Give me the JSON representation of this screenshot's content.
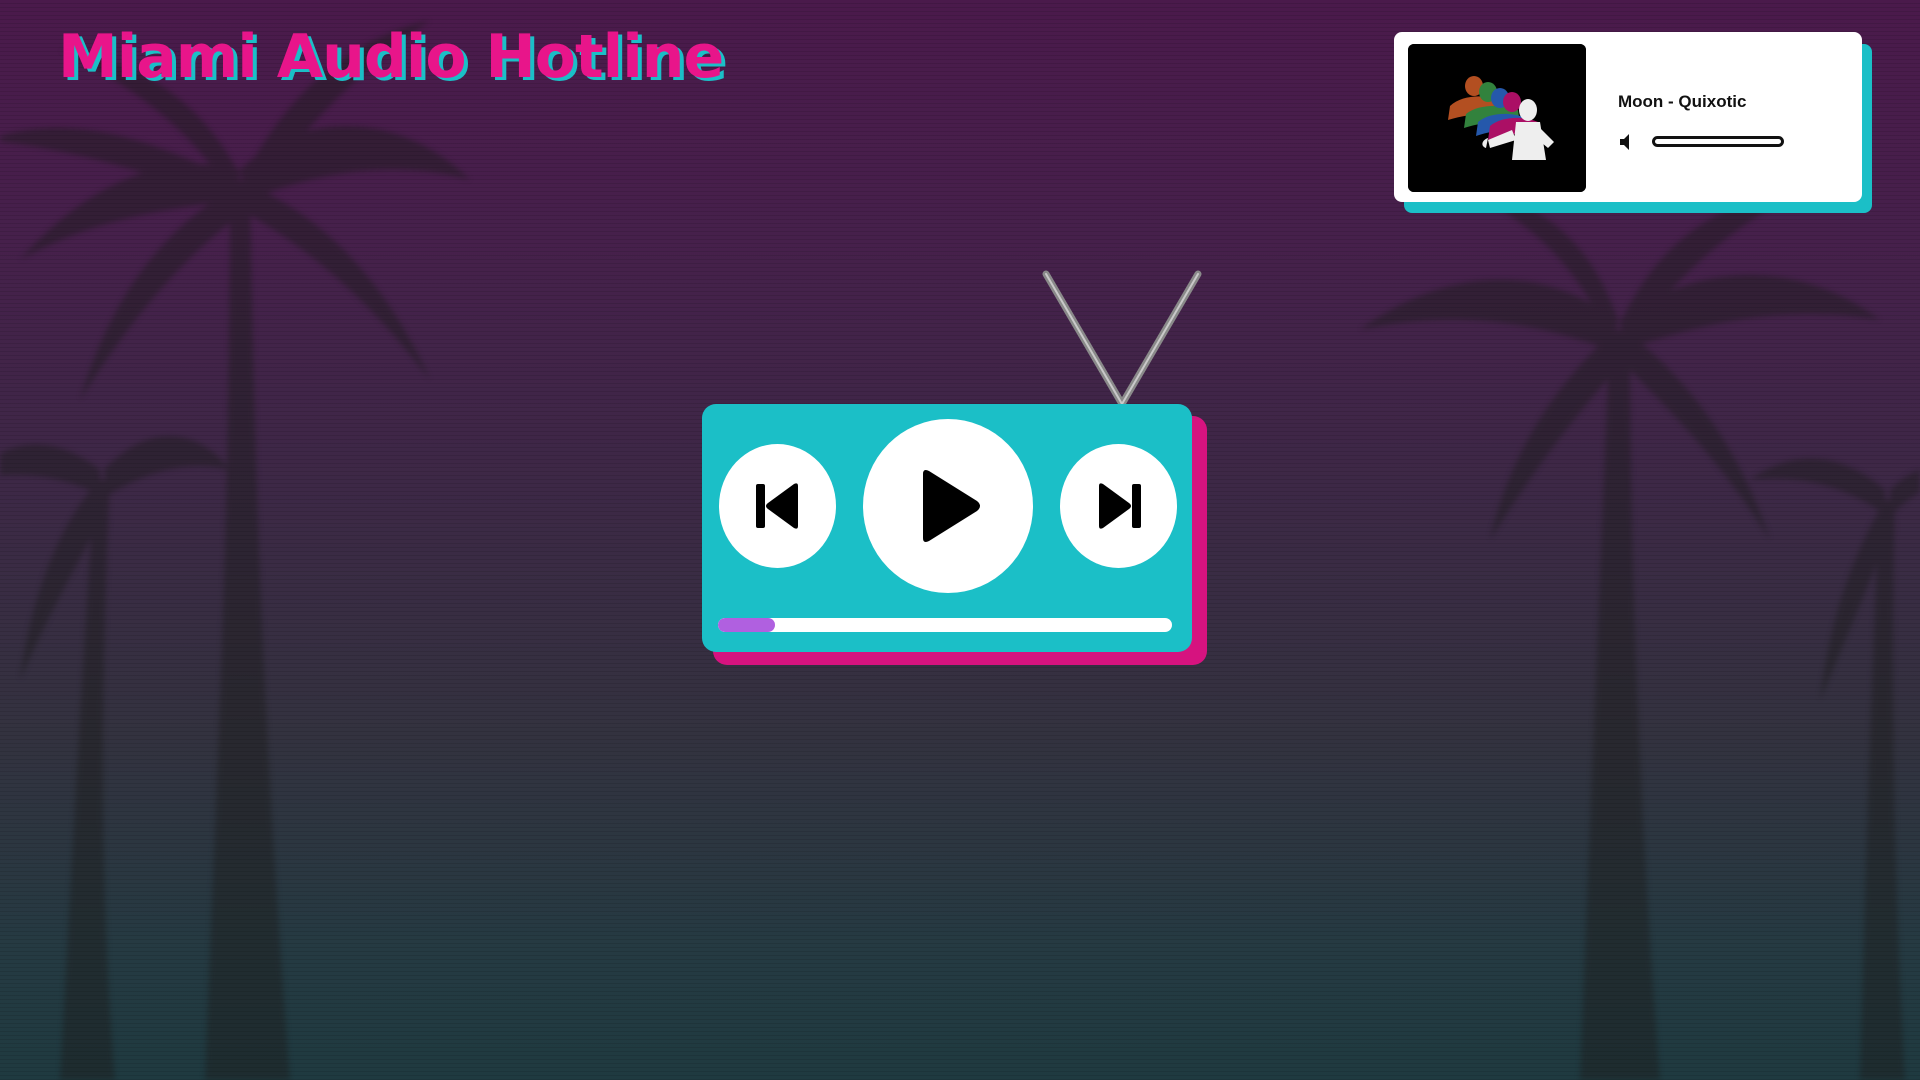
{
  "app": {
    "title": "Miami Audio Hotline"
  },
  "now_playing": {
    "track": "Moon - Quixotic",
    "volume": 0.0,
    "album_art_icon": "album-art-statue-image"
  },
  "player": {
    "progress": 0.125,
    "prev_icon": "skip-previous-icon",
    "play_icon": "play-icon",
    "next_icon": "skip-next-icon"
  },
  "colors": {
    "accent_pink": "#e8158a",
    "accent_cyan": "#1bbfc7",
    "progress_purple": "#b060e0",
    "tv_shadow_pink": "#d6137f"
  }
}
